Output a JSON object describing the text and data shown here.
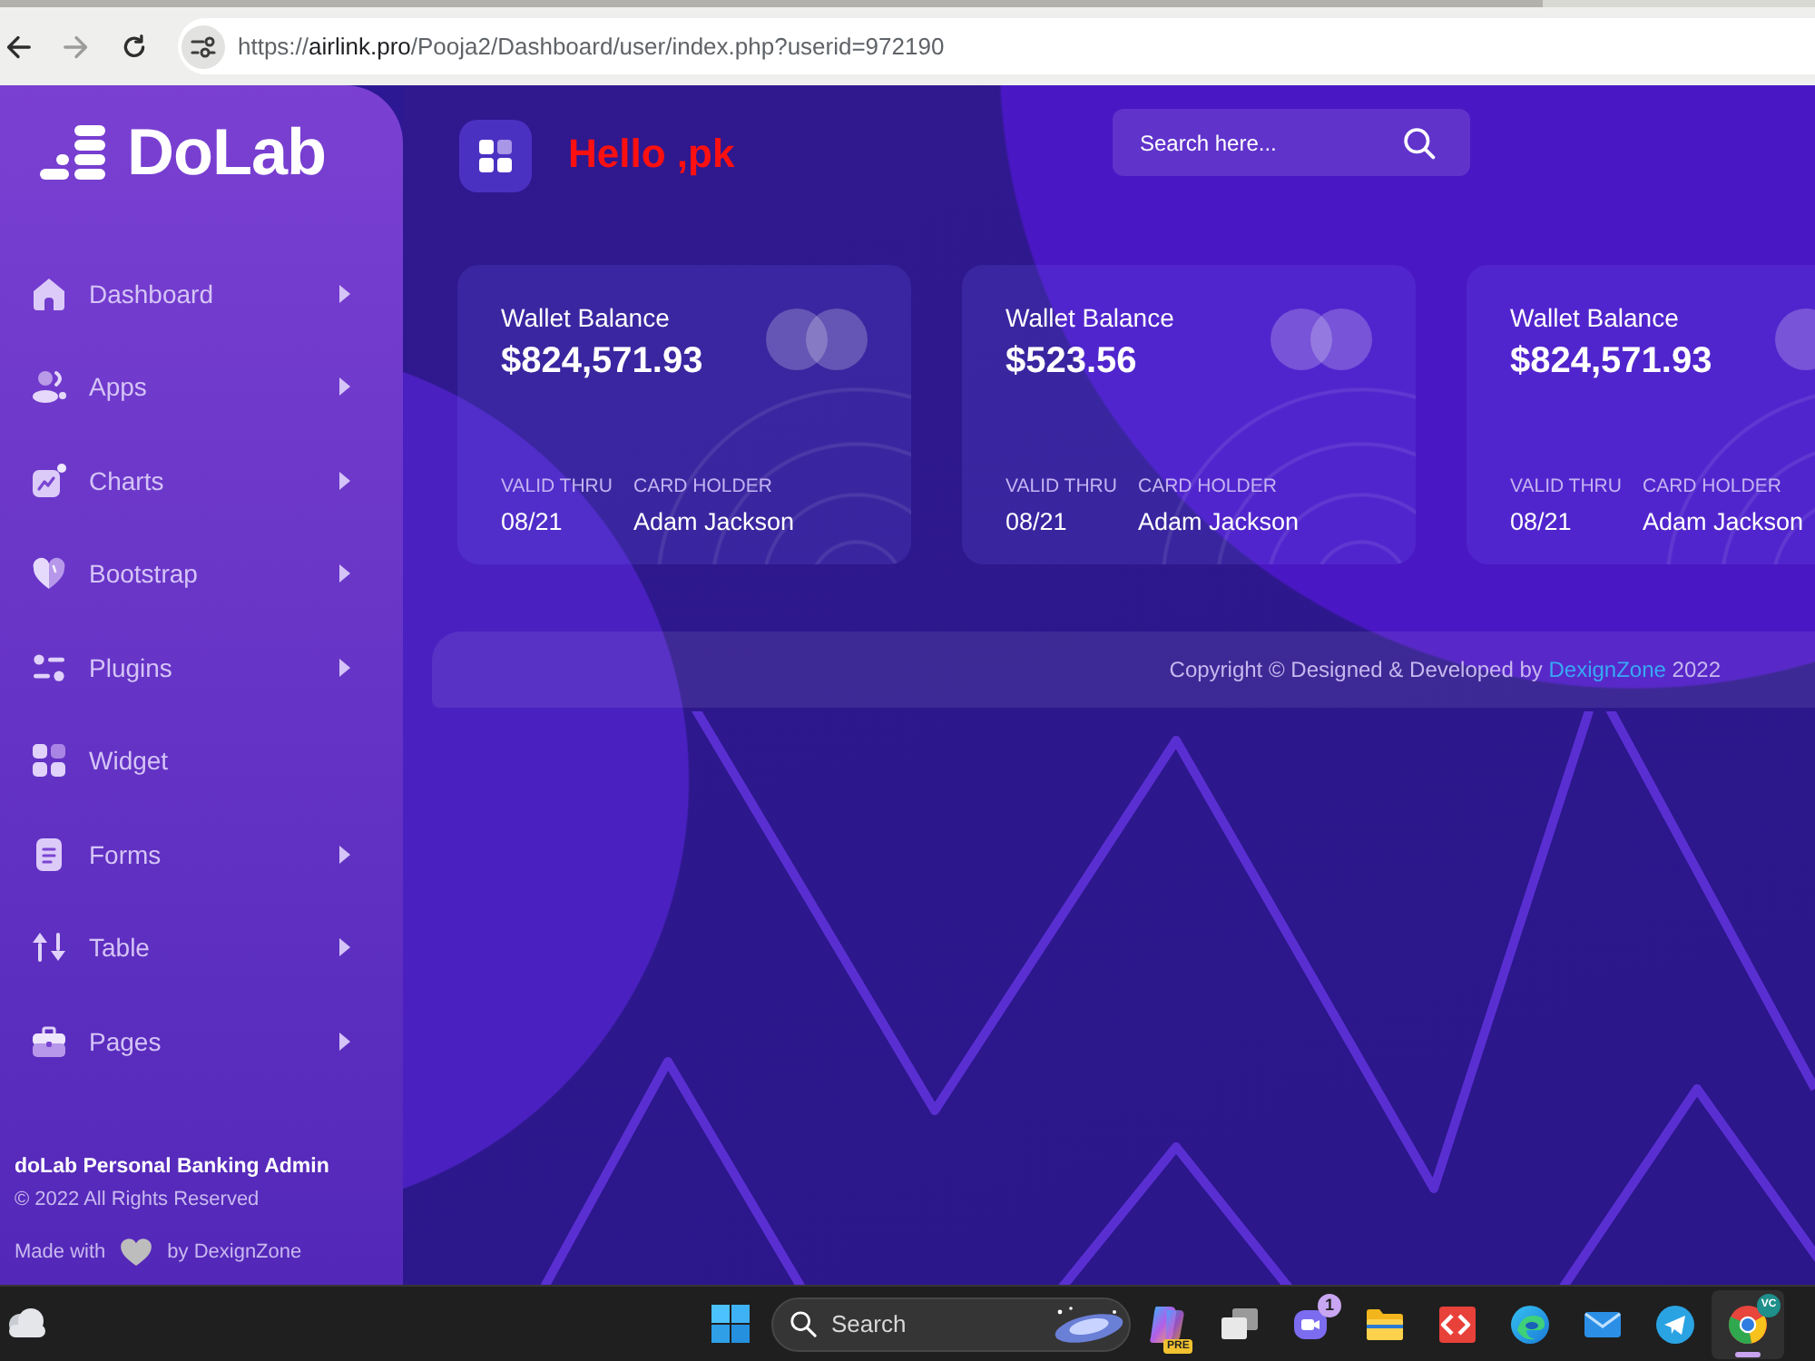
{
  "browser": {
    "nav": [
      {
        "kind": "back",
        "disabled": false
      },
      {
        "kind": "forward",
        "disabled": true
      },
      {
        "kind": "reload",
        "disabled": false
      }
    ],
    "url": {
      "scheme": "https://",
      "host": "airlink.pro",
      "path": "/Pooja2/Dashboard/user/index.php?userid=972190"
    }
  },
  "sidebar": {
    "logo": "DoLab",
    "items": [
      {
        "label": "Dashboard",
        "submenu": true,
        "selected": false
      },
      {
        "label": "Apps",
        "submenu": true,
        "selected": false
      },
      {
        "label": "Charts",
        "submenu": true,
        "selected": false
      },
      {
        "label": "Bootstrap",
        "submenu": true,
        "selected": false
      },
      {
        "label": "Plugins",
        "submenu": true,
        "selected": false
      },
      {
        "label": "Widget",
        "submenu": false,
        "selected": false
      },
      {
        "label": "Forms",
        "submenu": true,
        "selected": false
      },
      {
        "label": "Table",
        "submenu": true,
        "selected": false
      },
      {
        "label": "Pages",
        "submenu": true,
        "selected": false
      }
    ],
    "footer": {
      "title": "doLab Personal Banking Admin",
      "rights": "© 2022 All Rights Reserved",
      "made_with": "Made with",
      "made_by": "by DexignZone"
    }
  },
  "header": {
    "greeting": "Hello ,pk",
    "search": {
      "placeholder": "Search here..."
    }
  },
  "cards": [
    {
      "label": "Wallet Balance",
      "amount": "$824,571.93",
      "valid_label": "VALID THRU",
      "valid": "08/21",
      "holder_label": "CARD HOLDER",
      "holder": "Adam Jackson"
    },
    {
      "label": "Wallet Balance",
      "amount": "$523.56",
      "valid_label": "VALID THRU",
      "valid": "08/21",
      "holder_label": "CARD HOLDER",
      "holder": "Adam Jackson"
    },
    {
      "label": "Wallet Balance",
      "amount": "$824,571.93",
      "valid_label": "VALID THRU",
      "valid": "08/21",
      "holder_label": "CARD HOLDER",
      "holder": "Adam Jackson"
    }
  ],
  "footer": {
    "text": "Copyright © Designed & Developed by",
    "link": "DexignZone",
    "year": "2022"
  },
  "taskbar": {
    "search": {
      "placeholder": "Search"
    },
    "apps": [
      {
        "badge": "PRE",
        "selected": false
      },
      {
        "selected": false
      },
      {
        "badge": "1",
        "selected": false
      },
      {
        "selected": false
      },
      {
        "selected": false
      },
      {
        "selected": false
      },
      {
        "selected": false
      },
      {
        "selected": false
      },
      {
        "badge": "VC",
        "selected": true
      }
    ]
  }
}
